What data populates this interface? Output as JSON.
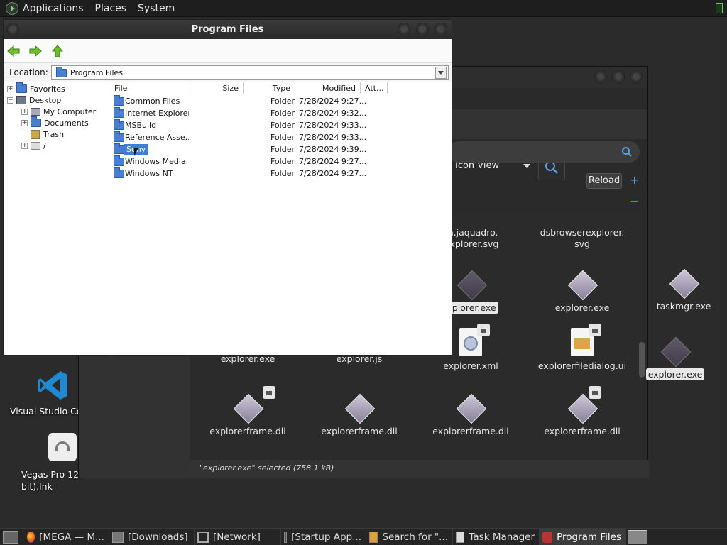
{
  "top_panel": {
    "menus": [
      "Applications",
      "Places",
      "System"
    ]
  },
  "desktop": {
    "icons": [
      {
        "label": "Visual Studio Co"
      },
      {
        "label": "Vegas Pro 12.\nbit).lnk"
      }
    ],
    "right_items": [
      {
        "label": "taskmgr.exe",
        "selected": false
      },
      {
        "label": "explorer.exe",
        "selected": true
      }
    ]
  },
  "file_manager": {
    "view_mode": "Icon View",
    "reload_label": "Reload",
    "status": "\"explorer.exe\" selected (758.1 kB)",
    "items": [
      {
        "label": "m.jaquadro.\nExplorer.svg",
        "selected": false
      },
      {
        "label": "dsbrowserexplorer.\nsvg",
        "selected": false
      },
      {
        "label": "xplorer.exe",
        "selected": true
      },
      {
        "label": "explorer.exe",
        "selected": false
      },
      {
        "label": "explorer.exe",
        "selected": false
      },
      {
        "label": "explorer.js",
        "selected": false
      },
      {
        "label": "explorer.xml",
        "selected": false
      },
      {
        "label": "explorerfiledialog.ui",
        "selected": false
      },
      {
        "label": "explorerframe.dll",
        "selected": false
      },
      {
        "label": "explorerframe.dll",
        "selected": false
      },
      {
        "label": "explorerframe.dll",
        "selected": false
      },
      {
        "label": "explorerframe.dll",
        "selected": false
      }
    ]
  },
  "dialog": {
    "title": "Program Files",
    "location_label": "Location:",
    "location_value": "Program Files",
    "tree": [
      {
        "label": "Favorites",
        "expander": "+"
      },
      {
        "label": "Desktop",
        "expander": "−"
      },
      {
        "label": "My Computer",
        "expander": "+"
      },
      {
        "label": "Documents",
        "expander": "+"
      },
      {
        "label": "Trash",
        "expander": ""
      },
      {
        "label": "/",
        "expander": "+"
      }
    ],
    "columns": [
      "File",
      "Size",
      "Type",
      "Modified",
      "Att..."
    ],
    "rows": [
      {
        "name": "Common Files",
        "size": "",
        "type": "Folder",
        "modified": "7/28/2024 9:27...",
        "selected": false
      },
      {
        "name": "Internet Explorer",
        "size": "",
        "type": "Folder",
        "modified": "7/28/2024 9:32...",
        "selected": false
      },
      {
        "name": "MSBuild",
        "size": "",
        "type": "Folder",
        "modified": "7/28/2024 9:33...",
        "selected": false
      },
      {
        "name": "Reference Asse...",
        "size": "",
        "type": "Folder",
        "modified": "7/28/2024 9:33...",
        "selected": false
      },
      {
        "name": "Sony",
        "size": "",
        "type": "Folder",
        "modified": "7/28/2024 9:39...",
        "selected": true
      },
      {
        "name": "Windows Media...",
        "size": "",
        "type": "Folder",
        "modified": "7/28/2024 9:27...",
        "selected": false
      },
      {
        "name": "Windows NT",
        "size": "",
        "type": "Folder",
        "modified": "7/28/2024 9:27...",
        "selected": false
      }
    ]
  },
  "taskbar": {
    "tasks": [
      {
        "label": "[MEGA — M...",
        "icon": "firefox-icon",
        "active": false
      },
      {
        "label": "[Downloads]",
        "icon": "folder-icon",
        "active": false
      },
      {
        "label": "[Network]",
        "icon": "network-icon",
        "active": false
      },
      {
        "label": "[Startup App...",
        "icon": "startup-icon",
        "active": false
      },
      {
        "label": "Search for \"...",
        "icon": "search-icon",
        "active": false
      },
      {
        "label": "Task Manager",
        "icon": "task-manager-icon",
        "active": false
      },
      {
        "label": "Program Files",
        "icon": "wine-icon",
        "active": true
      }
    ]
  },
  "colors": {
    "accent": "#3d7fd6",
    "selection_text": "#ffffff"
  }
}
